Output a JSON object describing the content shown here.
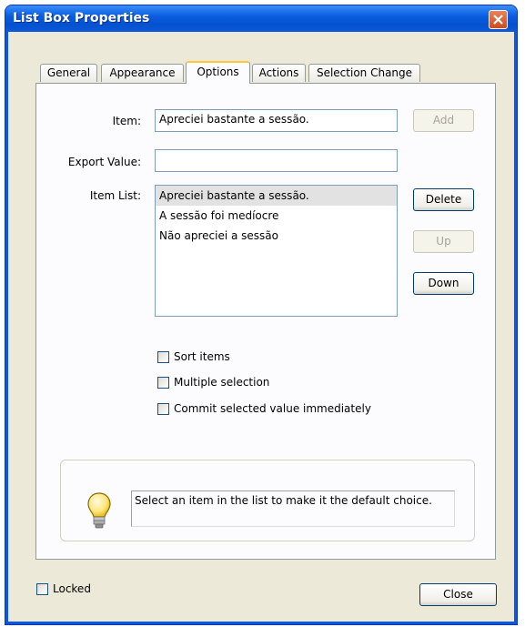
{
  "window": {
    "title": "List Box Properties"
  },
  "tabs": [
    {
      "label": "General"
    },
    {
      "label": "Appearance"
    },
    {
      "label": "Options",
      "active": true
    },
    {
      "label": "Actions"
    },
    {
      "label": "Selection Change"
    }
  ],
  "options": {
    "item_label": "Item:",
    "item_value": "Apreciei bastante a sessão.",
    "add_label": "Add",
    "export_label": "Export Value:",
    "export_value": "",
    "item_list_label": "Item List:",
    "items": [
      {
        "text": "Apreciei bastante a sessão.",
        "selected": true
      },
      {
        "text": "A sessão foi medíocre",
        "selected": false
      },
      {
        "text": "Não apreciei a sessão",
        "selected": false
      }
    ],
    "delete_label": "Delete",
    "up_label": "Up",
    "down_label": "Down",
    "sort_label": "Sort items",
    "sort_checked": false,
    "multiple_label": "Multiple selection",
    "multiple_checked": false,
    "commit_label": "Commit selected value immediately",
    "commit_checked": false,
    "hint": "Select an item in the list to make it the default choice."
  },
  "footer": {
    "locked_label": "Locked",
    "locked_checked": false,
    "close_label": "Close"
  },
  "colors": {
    "titlebar": "#0a5ee0",
    "active_tab_accent": "#ffc83c",
    "selected_item": "#e2e2e2"
  },
  "icons": {
    "close": "close-icon",
    "hint": "lightbulb-icon"
  }
}
